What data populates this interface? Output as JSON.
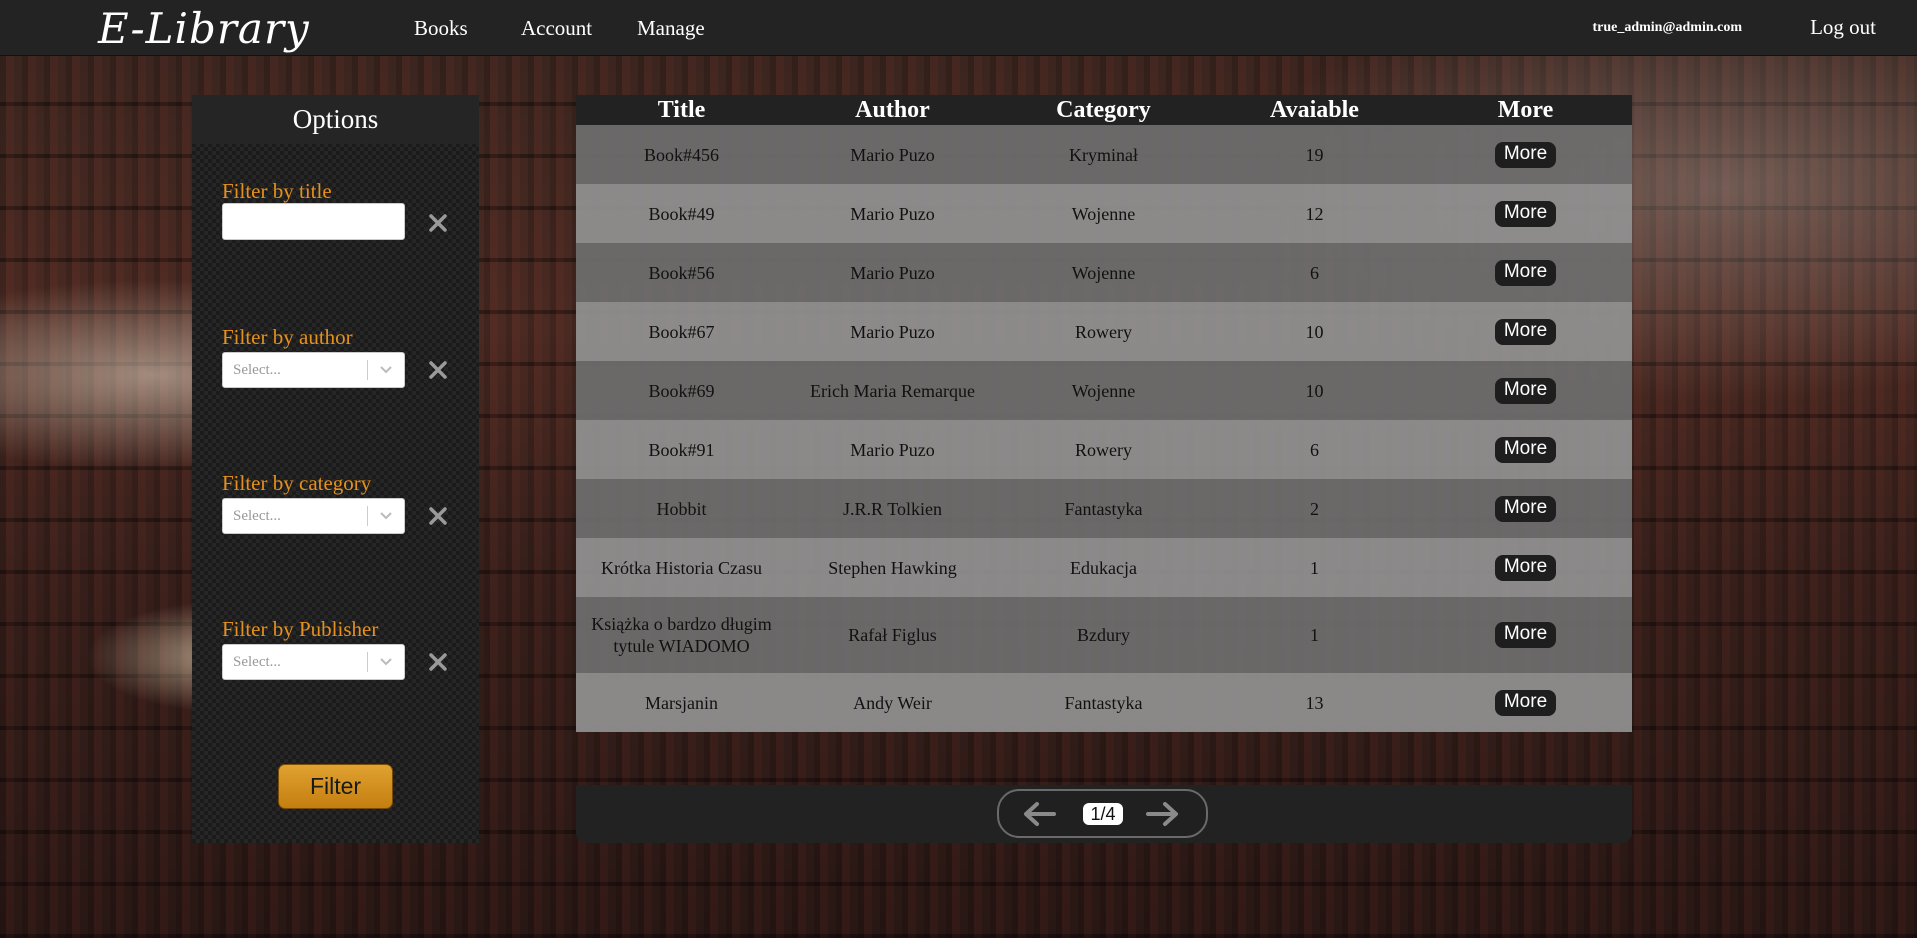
{
  "navbar": {
    "logo": "E-Library",
    "links": [
      "Books",
      "Account",
      "Manage"
    ],
    "user_email": "true_admin@admin.com",
    "logout": "Log out"
  },
  "options": {
    "title": "Options",
    "title_filter": {
      "label": "Filter by title",
      "value": ""
    },
    "author_filter": {
      "label": "Filter by author",
      "placeholder": "Select..."
    },
    "category_filter": {
      "label": "Filter by category",
      "placeholder": "Select..."
    },
    "publisher_filter": {
      "label": "Filter by Publisher",
      "placeholder": "Select..."
    },
    "filter_button": "Filter"
  },
  "table": {
    "headers": [
      "Title",
      "Author",
      "Category",
      "Avaiable",
      "More"
    ],
    "more_label": "More",
    "rows": [
      {
        "title": "Book#456",
        "author": "Mario Puzo",
        "category": "Kryminał",
        "available": "19"
      },
      {
        "title": "Book#49",
        "author": "Mario Puzo",
        "category": "Wojenne",
        "available": "12"
      },
      {
        "title": "Book#56",
        "author": "Mario Puzo",
        "category": "Wojenne",
        "available": "6"
      },
      {
        "title": "Book#67",
        "author": "Mario Puzo",
        "category": "Rowery",
        "available": "10"
      },
      {
        "title": "Book#69",
        "author": "Erich Maria Remarque",
        "category": "Wojenne",
        "available": "10"
      },
      {
        "title": "Book#91",
        "author": "Mario Puzo",
        "category": "Rowery",
        "available": "6"
      },
      {
        "title": "Hobbit",
        "author": "J.R.R Tolkien",
        "category": "Fantastyka",
        "available": "2"
      },
      {
        "title": "Krótka Historia Czasu",
        "author": "Stephen Hawking",
        "category": "Edukacja",
        "available": "1"
      },
      {
        "title": "Książka o bardzo długim tytule WIADOMO",
        "author": "Rafał Figlus",
        "category": "Bzdury",
        "available": "1"
      },
      {
        "title": "Marsjanin",
        "author": "Andy Weir",
        "category": "Fantastyka",
        "available": "13"
      }
    ]
  },
  "pagination": {
    "page": "1/4"
  },
  "colors": {
    "accent": "#e8901c",
    "navbar": "#232323"
  }
}
